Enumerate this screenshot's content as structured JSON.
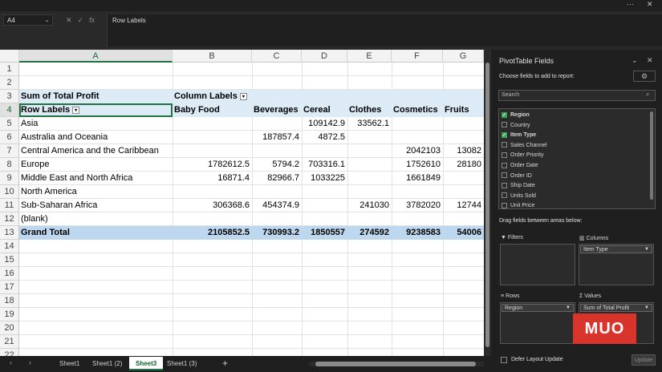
{
  "window": {
    "more": "···",
    "close": "✕"
  },
  "formula": {
    "name_box": "A4",
    "fx": "fx",
    "content": "Row Labels"
  },
  "grid": {
    "columns": [
      "A",
      "B",
      "C",
      "D",
      "E",
      "F",
      "G"
    ],
    "rows": [
      "1",
      "2",
      "3",
      "4",
      "5",
      "6",
      "7",
      "8",
      "9",
      "10",
      "11",
      "12",
      "13",
      "14",
      "15",
      "16",
      "17",
      "18",
      "19",
      "20",
      "21",
      "22"
    ],
    "pivot": {
      "sum_label": "Sum of Total Profit",
      "col_labels": "Column Labels",
      "row_labels": "Row Labels",
      "headers": [
        "Baby Food",
        "Beverages",
        "Cereal",
        "Clothes",
        "Cosmetics",
        "Fruits"
      ],
      "body": [
        {
          "label": "Asia",
          "v": [
            "",
            "",
            "109142.9",
            "33562.1",
            "",
            ""
          ]
        },
        {
          "label": "Australia and Oceania",
          "v": [
            "",
            "187857.4",
            "4872.5",
            "",
            "",
            ""
          ]
        },
        {
          "label": "Central America and the Caribbean",
          "v": [
            "",
            "",
            "",
            "",
            "2042103",
            "13082"
          ]
        },
        {
          "label": "Europe",
          "v": [
            "1782612.5",
            "5794.2",
            "703316.1",
            "",
            "1752610",
            "28180"
          ]
        },
        {
          "label": "Middle East and North Africa",
          "v": [
            "16871.4",
            "82966.7",
            "1033225",
            "",
            "1661849",
            ""
          ]
        },
        {
          "label": "North America",
          "v": [
            "",
            "",
            "",
            "",
            "",
            ""
          ]
        },
        {
          "label": "Sub-Saharan Africa",
          "v": [
            "306368.6",
            "454374.9",
            "",
            "241030",
            "3782020",
            "12744"
          ]
        },
        {
          "label": "(blank)",
          "v": [
            "",
            "",
            "",
            "",
            "",
            ""
          ]
        }
      ],
      "total": {
        "label": "Grand Total",
        "v": [
          "2105852.5",
          "730993.2",
          "1850557",
          "274592",
          "9238583",
          "54006"
        ]
      }
    }
  },
  "tabs": [
    "Sheet1",
    "Sheet1 (2)",
    "Sheet3",
    "Sheet1 (3)"
  ],
  "active_tab": "Sheet3",
  "add_sheet": "+",
  "pane": {
    "title": "PivotTable Fields",
    "subtitle": "Choose fields to add to report:",
    "search_placeholder": "Search",
    "fields": [
      {
        "name": "Region",
        "checked": true
      },
      {
        "name": "Country",
        "checked": false
      },
      {
        "name": "Item Type",
        "checked": true
      },
      {
        "name": "Sales Channel",
        "checked": false
      },
      {
        "name": "Order Priority",
        "checked": false
      },
      {
        "name": "Order Date",
        "checked": false
      },
      {
        "name": "Order ID",
        "checked": false
      },
      {
        "name": "Ship Date",
        "checked": false
      },
      {
        "name": "Units Sold",
        "checked": false
      },
      {
        "name": "Unit Price",
        "checked": false
      }
    ],
    "drag_label": "Drag fields between areas below:",
    "filters": "Filters",
    "columns": "Columns",
    "rows": "Rows",
    "values": "Values",
    "columns_chip": "Item Type",
    "rows_chip": "Region",
    "values_chip": "Sum of Total Profit",
    "defer": "Defer Layout Update",
    "update": "Update"
  },
  "watermark": "MUO"
}
